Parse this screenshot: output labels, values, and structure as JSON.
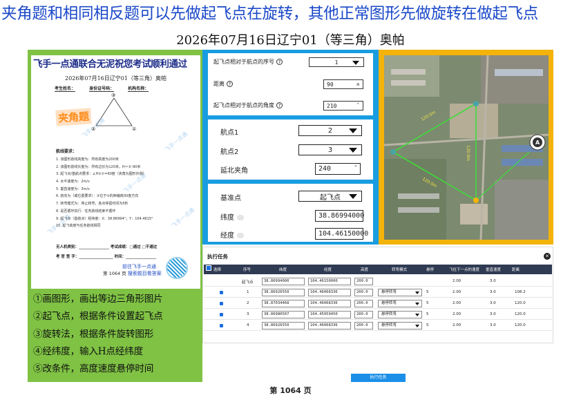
{
  "banner": "夹角题和相同相反题可以先做起飞点在旋转，其他正常图形先做旋转在做起飞点",
  "doc_title": "2026年07月16日辽宁01（等三角）奥帕",
  "paper": {
    "header": "飞手一点通联合无泥祝您考试顺利通过",
    "subtitle": "2026年07月16日辽宁01（等三角）奥帕",
    "fields": [
      "考生姓名：",
      "身份证号码：",
      "机构名称："
    ],
    "stamp": "夹角题",
    "vertex_labels": [
      "①",
      "②",
      "③"
    ],
    "section": "航线要求：",
    "requirements": [
      "1. 该图形航线高度为：所有高度为200米",
      "2. 该图形航线长度为：所有边长为120米，H＝②-90米",
      "3. 起飞点/基航点要求：∠H②①=60度（夹角为图形外侧）",
      "4. 水平速度为：2m/s",
      "5. 垂直速度为：3m/s",
      "6. 航向为（或位置要求）：③位于②的西偏南30度方向",
      "7. 转弯模式为：停止转弯，各点停留时间为5秒",
      "8. 是否循环执行：任务航线结束不循环",
      "9. 起飞点（基航点）经纬度：X：38.86994°，Y：104.4615°",
      "10. 起飞高度与任务航线相同"
    ],
    "sign1": "无人机类别：________________ 考试成绩：□通过 □不通过",
    "sign2": "考 官 签 字：__________________ 时间：________________",
    "footer_line1": "前往飞手一点通",
    "footer_page": "第 1064 页",
    "footer_line2": "搜索题目看答案",
    "watermark": "飞手一点通"
  },
  "steps": [
    "①画图形，画出等边三角形图片",
    "②起飞点，根据条件设置起飞点",
    "③旋转法，根据条件旋转图形",
    "④经纬度，输入H点经纬度",
    "⑤改条件，高度速度悬停时间"
  ],
  "form1": {
    "row1_label": "起飞点相对于航点的序号",
    "row1_value": "1",
    "row2_label": "距离",
    "row2_value": "90",
    "row2_unit": "m",
    "row3_label": "起飞点相对于航点的角度",
    "row3_value": "210",
    "help": "?",
    "spin": "⌃"
  },
  "form2": {
    "wp1_label": "航点1",
    "wp1_value": "2",
    "wp2_label": "航点2",
    "wp2_value": "3",
    "angle_label": "延北夹角",
    "angle_value": "240"
  },
  "form3": {
    "base_label": "基准点",
    "base_value": "起飞点",
    "lat_label": "纬度",
    "lat_value": "38.86994000",
    "lon_label": "经度",
    "lon_value": "104.46150000"
  },
  "map": {
    "labels": [
      "120.0m",
      "120.0m",
      "120.0m"
    ],
    "compass": "A"
  },
  "task": {
    "title": "执行任务",
    "close": "✕",
    "headers": [
      "选择",
      "序号",
      "纬度",
      "经度",
      "高度",
      "转弯模式",
      "悬停",
      "飞往下一点的速度",
      "垂直速度",
      "距离"
    ],
    "rows": [
      {
        "seq": "起飞点",
        "lat": "38.86994000",
        "lon": "104.46150000",
        "alt": "200.0",
        "mode": "",
        "hover": "",
        "speed": "2.00",
        "vspeed": "3.0",
        "dist": ""
      },
      {
        "seq": "1",
        "lat": "38.86926550",
        "lon": "104.46068336",
        "alt": "200.0",
        "mode": "悬停转弯",
        "hover": "5",
        "speed": "2.00",
        "vspeed": "3.0",
        "dist": "108.2"
      },
      {
        "seq": "2",
        "lat": "38.87034468",
        "lon": "104.46068336",
        "alt": "200.0",
        "mode": "悬停转弯",
        "hover": "5",
        "speed": "2.00",
        "vspeed": "3.0",
        "dist": "120.0"
      },
      {
        "seq": "3",
        "lat": "38.86980507",
        "lon": "104.45959450",
        "alt": "200.0",
        "mode": "悬停转弯",
        "hover": "5",
        "speed": "2.00",
        "vspeed": "3.0",
        "dist": "120.0"
      },
      {
        "seq": "4",
        "lat": "38.86926550",
        "lon": "104.46068336",
        "alt": "200.0",
        "mode": "悬停转弯",
        "hover": "5",
        "speed": "2.00",
        "vspeed": "3.0",
        "dist": "120.0"
      }
    ],
    "execute": "执行任务"
  },
  "page_number": "第  1064  页",
  "colors": {
    "banner": "#1a48c8",
    "green": "#7fc244",
    "blue": "#1a9de0",
    "orange": "#f4b30a",
    "table_header": "#2f3a53"
  }
}
